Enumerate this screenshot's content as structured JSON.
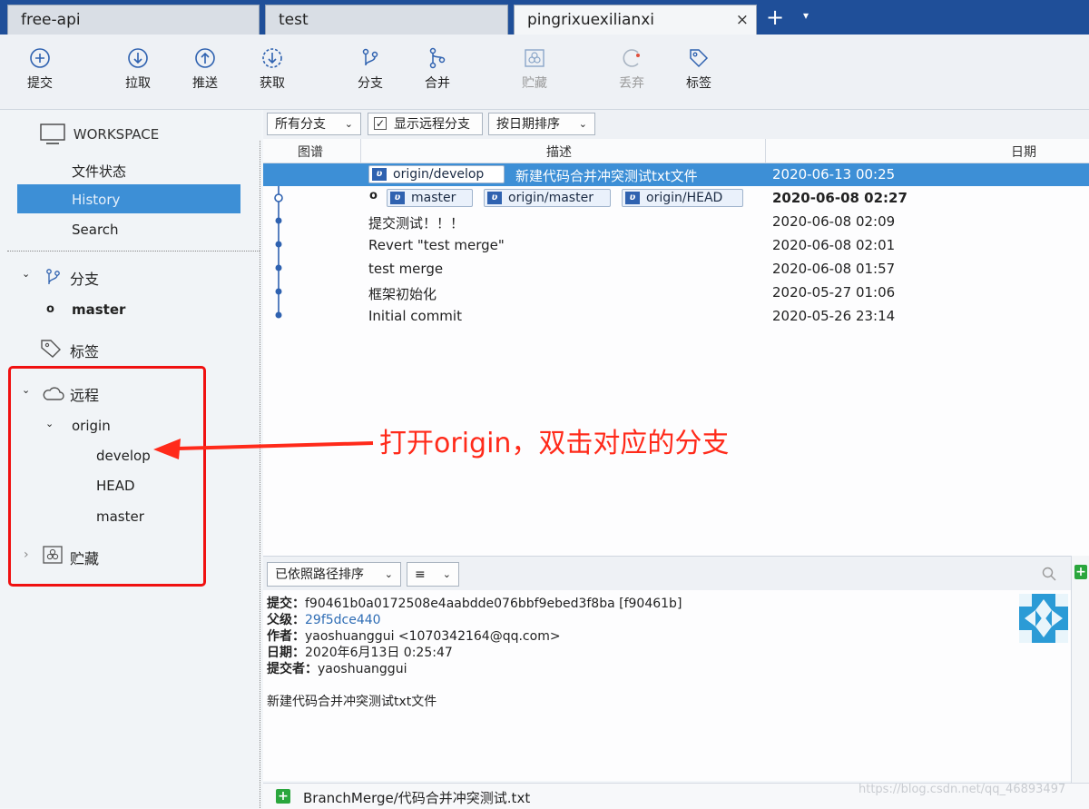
{
  "tabs": [
    {
      "label": "free-api"
    },
    {
      "label": "test"
    },
    {
      "label": "pingrixuexilianxi",
      "close": "×"
    }
  ],
  "tab_add": "+",
  "tab_menu": "▾",
  "toolbar": {
    "commit": "提交",
    "pull": "拉取",
    "push": "推送",
    "fetch": "获取",
    "branch": "分支",
    "merge": "合并",
    "stash": "贮藏",
    "discard": "丢弃",
    "tag": "标签"
  },
  "sidebar": {
    "workspace": "WORKSPACE",
    "file_status": "文件状态",
    "history": "History",
    "search": "Search",
    "branches_label": "分支",
    "current_branch": "master",
    "tags_label": "标签",
    "remotes_label": "远程",
    "origin": "origin",
    "remote_branches": [
      "develop",
      "HEAD",
      "master"
    ],
    "stashes_label": "贮藏"
  },
  "filter": {
    "all_branches": "所有分支",
    "show_remote": "显示远程分支",
    "sort_by_date": "按日期排序"
  },
  "columns": {
    "graph": "图谱",
    "desc": "描述",
    "date": "日期"
  },
  "commits": [
    {
      "tags": [
        "origin/develop"
      ],
      "desc": "新建代码合并冲突测试txt文件",
      "date": "2020-06-13 00:25"
    },
    {
      "tags": [
        "master",
        "origin/master",
        "origin/HEAD"
      ],
      "desc": "",
      "date": "2020-06-08 02:27"
    },
    {
      "desc": "提交测试！！！",
      "date": "2020-06-08 02:09"
    },
    {
      "desc": "Revert \"test merge\"",
      "date": "2020-06-08 02:01"
    },
    {
      "desc": "test merge",
      "date": "2020-06-08 01:57"
    },
    {
      "desc": "框架初始化",
      "date": "2020-05-27 01:06"
    },
    {
      "desc": "Initial commit",
      "date": "2020-05-26 23:14"
    }
  ],
  "annotation": "打开origin，双击对应的分支",
  "bottom": {
    "sort_path": "已依照路径排序",
    "view_mode": "≡"
  },
  "detail": {
    "commit_k": "提交：",
    "commit_v": "f90461b0a0172508e4aabdde076bbf9ebed3f8ba [f90461b]",
    "parent_k": "父级：",
    "parent_v": "29f5dce440",
    "author_k": "作者：",
    "author_v": "yaoshuanggui <1070342164@qq.com>",
    "date_k": "日期：",
    "date_v": "2020年6月13日 0:25:47",
    "committer_k": "提交者：",
    "committer_v": "yaoshuanggui",
    "message": "新建代码合并冲突测试txt文件"
  },
  "file": "BranchMerge/代码合并冲突测试.txt",
  "watermark": "https://blog.csdn.net/qq_46893497",
  "colors": {
    "accent": "#3d8fd6",
    "tabbar": "#1f4f99",
    "annotation": "#ff2a1a"
  }
}
